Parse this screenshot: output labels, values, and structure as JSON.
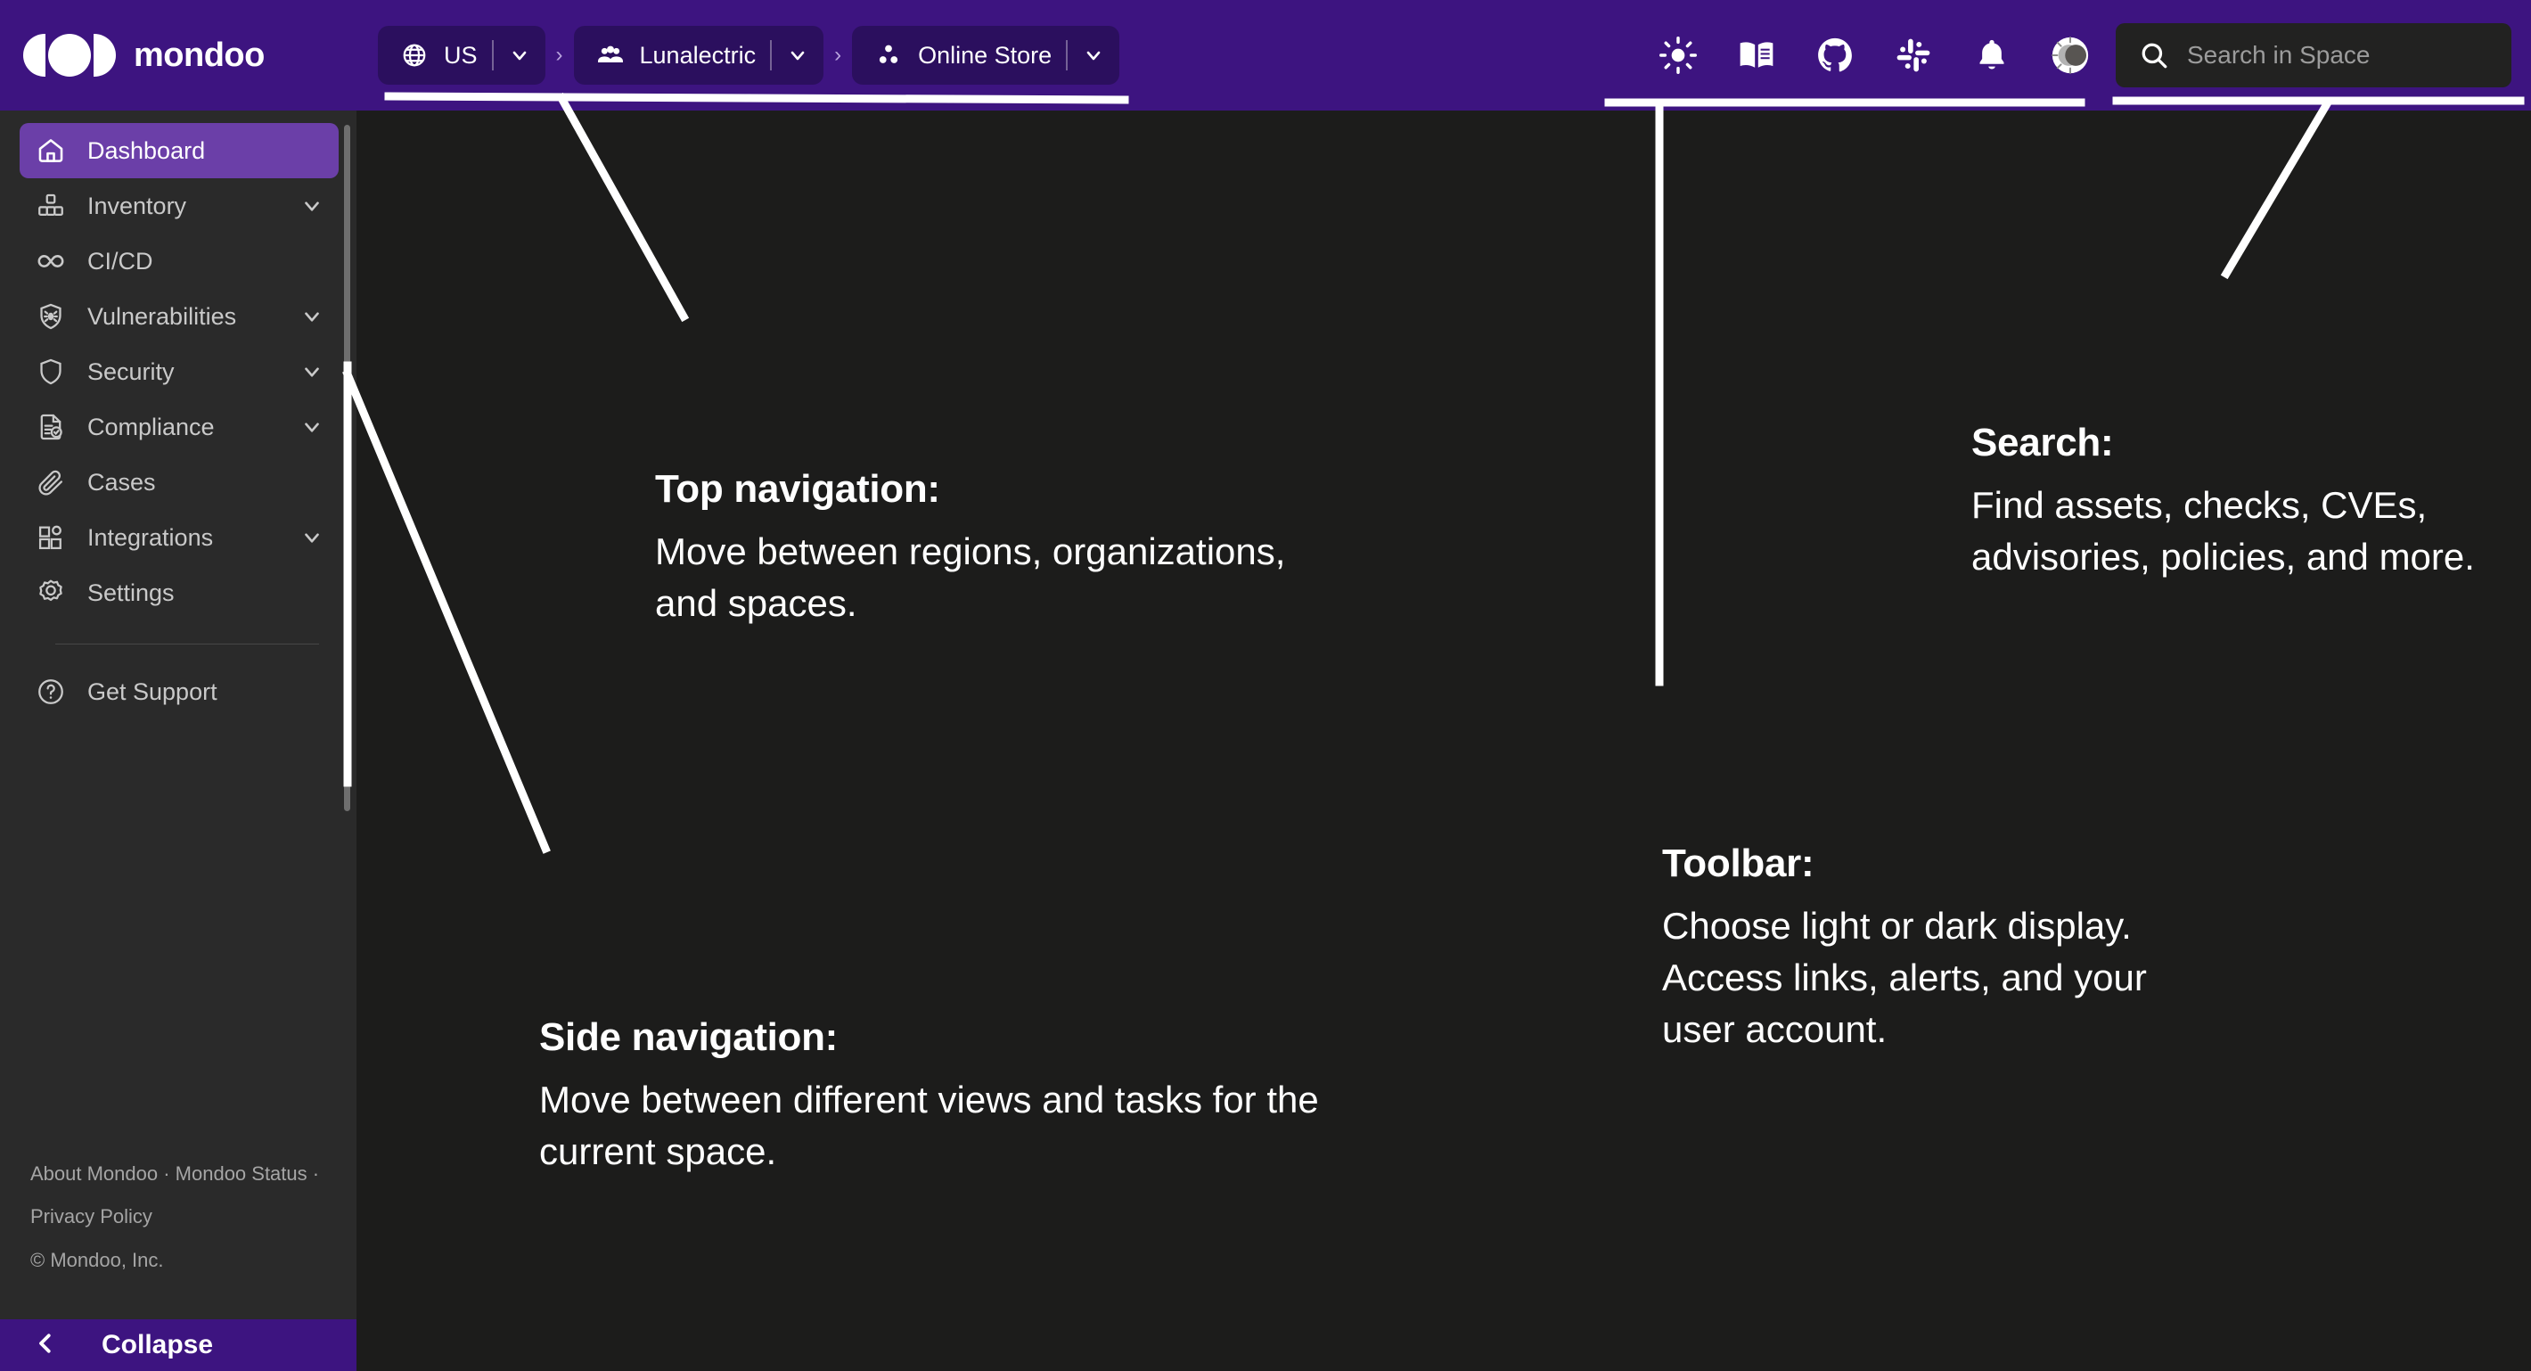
{
  "brand": {
    "name": "mondoo",
    "logo_icon": "mondoo-logo"
  },
  "topnav": {
    "breadcrumbs": [
      {
        "label": "US",
        "icon": "globe-icon",
        "chevron": "chevron-down-icon"
      },
      {
        "label": "Lunalectric",
        "icon": "organization-people-icon",
        "chevron": "chevron-down-icon"
      },
      {
        "label": "Online Store",
        "icon": "space-dots-icon",
        "chevron": "chevron-down-icon"
      }
    ],
    "separator": "›"
  },
  "toolbar": {
    "items": [
      {
        "name": "theme-sun-icon",
        "title": "Light mode"
      },
      {
        "name": "docs-book-icon",
        "title": "Documentation"
      },
      {
        "name": "github-icon",
        "title": "GitHub"
      },
      {
        "name": "slack-icon",
        "title": "Slack"
      },
      {
        "name": "notifications-bell-icon",
        "title": "Notifications"
      },
      {
        "name": "user-account-avatar-icon",
        "title": "Account"
      }
    ]
  },
  "search": {
    "placeholder": "Search in Space",
    "icon": "search-icon"
  },
  "sidebar": {
    "items": [
      {
        "label": "Dashboard",
        "icon": "home-icon",
        "active": true,
        "expandable": false
      },
      {
        "label": "Inventory",
        "icon": "inventory-boxes-icon",
        "active": false,
        "expandable": true
      },
      {
        "label": "CI/CD",
        "icon": "infinity-icon",
        "active": false,
        "expandable": false
      },
      {
        "label": "Vulnerabilities",
        "icon": "shield-bug-icon",
        "active": false,
        "expandable": true
      },
      {
        "label": "Security",
        "icon": "shield-icon",
        "active": false,
        "expandable": true
      },
      {
        "label": "Compliance",
        "icon": "document-check-icon",
        "active": false,
        "expandable": true
      },
      {
        "label": "Cases",
        "icon": "paperclip-icon",
        "active": false,
        "expandable": false
      },
      {
        "label": "Integrations",
        "icon": "integrations-grid-icon",
        "active": false,
        "expandable": true
      },
      {
        "label": "Settings",
        "icon": "gear-icon",
        "active": false,
        "expandable": false
      }
    ],
    "support": {
      "label": "Get Support",
      "icon": "help-circle-icon"
    },
    "footer": {
      "line1": "About Mondoo · Mondoo Status ·",
      "line2": "Privacy Policy",
      "copyright": "© Mondoo, Inc."
    },
    "collapse": {
      "label": "Collapse",
      "icon": "chevron-left-icon"
    }
  },
  "annotations": [
    {
      "id": "top-navigation",
      "title": "Top navigation:",
      "body": "Move between regions, organizations, and spaces."
    },
    {
      "id": "side-navigation",
      "title": "Side navigation:",
      "body": "Move between different views and tasks for the current space."
    },
    {
      "id": "toolbar",
      "title": "Toolbar:",
      "body": "Choose light or dark display. Access links, alerts, and your user account."
    },
    {
      "id": "search",
      "title": "Search:",
      "body": "Find assets, checks, CVEs, advisories, policies, and more."
    }
  ],
  "colors": {
    "brand_purple": "#3d1480",
    "pill_purple": "#2b0f5e",
    "active_purple": "#6b3fa8",
    "sidebar_bg": "#2a2a2a",
    "main_bg": "#1c1c1b",
    "callout_line": "#ffffff",
    "search_bg": "#222221"
  }
}
